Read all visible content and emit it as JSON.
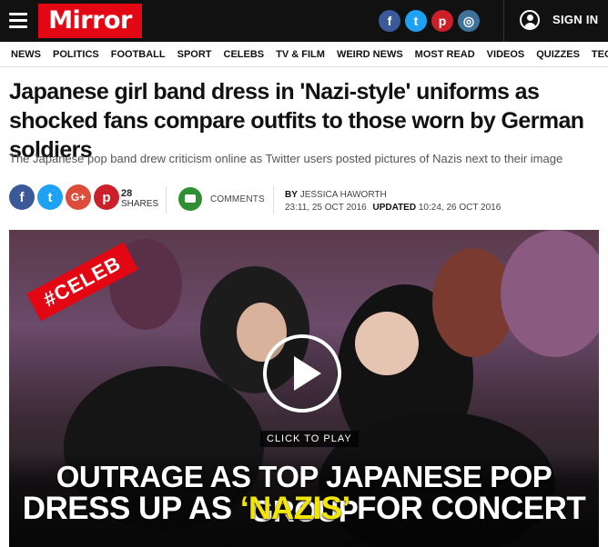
{
  "topbar": {
    "logo": "Mirror",
    "social": [
      {
        "icon": "facebook-icon",
        "glyph": "f",
        "color": "#3b5998"
      },
      {
        "icon": "twitter-icon",
        "glyph": "t",
        "color": "#1da1f2"
      },
      {
        "icon": "pinterest-icon",
        "glyph": "p",
        "color": "#cb2027"
      },
      {
        "icon": "instagram-icon",
        "glyph": "◎",
        "color": "#3f729b"
      }
    ],
    "signin": "SIGN IN"
  },
  "nav": {
    "items": [
      "NEWS",
      "POLITICS",
      "FOOTBALL",
      "SPORT",
      "CELEBS",
      "TV & FILM",
      "WEIRD NEWS",
      "MOST READ",
      "VIDEOS",
      "QUIZZES",
      "TECHNOLOGY"
    ]
  },
  "article": {
    "headline": "Japanese girl band dress in 'Nazi-style' uniforms as shocked fans compare outfits to those worn by German soldiers",
    "subhead": "The Japanese pop band drew criticism online as Twitter users posted pictures of Nazis next to their image",
    "share": {
      "buttons": [
        {
          "icon": "facebook-icon",
          "glyph": "f",
          "color": "#3b5998"
        },
        {
          "icon": "twitter-icon",
          "glyph": "t",
          "color": "#1da1f2"
        },
        {
          "icon": "googleplus-icon",
          "glyph": "G+",
          "color": "#dd4b39"
        },
        {
          "icon": "pinterest-icon",
          "glyph": "p",
          "color": "#cb2027"
        }
      ],
      "count": "28",
      "count_label": "SHARES"
    },
    "comments_label": "COMMENTS",
    "byline": {
      "by": "BY",
      "author": "JESSICA HAWORTH",
      "published": "23:11, 25 OCT 2016",
      "updated_label": "UPDATED",
      "updated": "10:24, 26 OCT 2016"
    }
  },
  "video": {
    "badge": "#CELEB",
    "click_to_play": "CLICK TO PLAY",
    "caption_line1": "OUTRAGE AS TOP JAPANESE POP GROUP",
    "caption_line2_pre": "DRESS UP AS ",
    "caption_line2_hl": "‘NAZIS’",
    "caption_line2_post": " FOR CONCERT"
  },
  "colors": {
    "brand_red": "#e30613",
    "caption_highlight": "#f2e600",
    "comments_green": "#2f8f33"
  }
}
